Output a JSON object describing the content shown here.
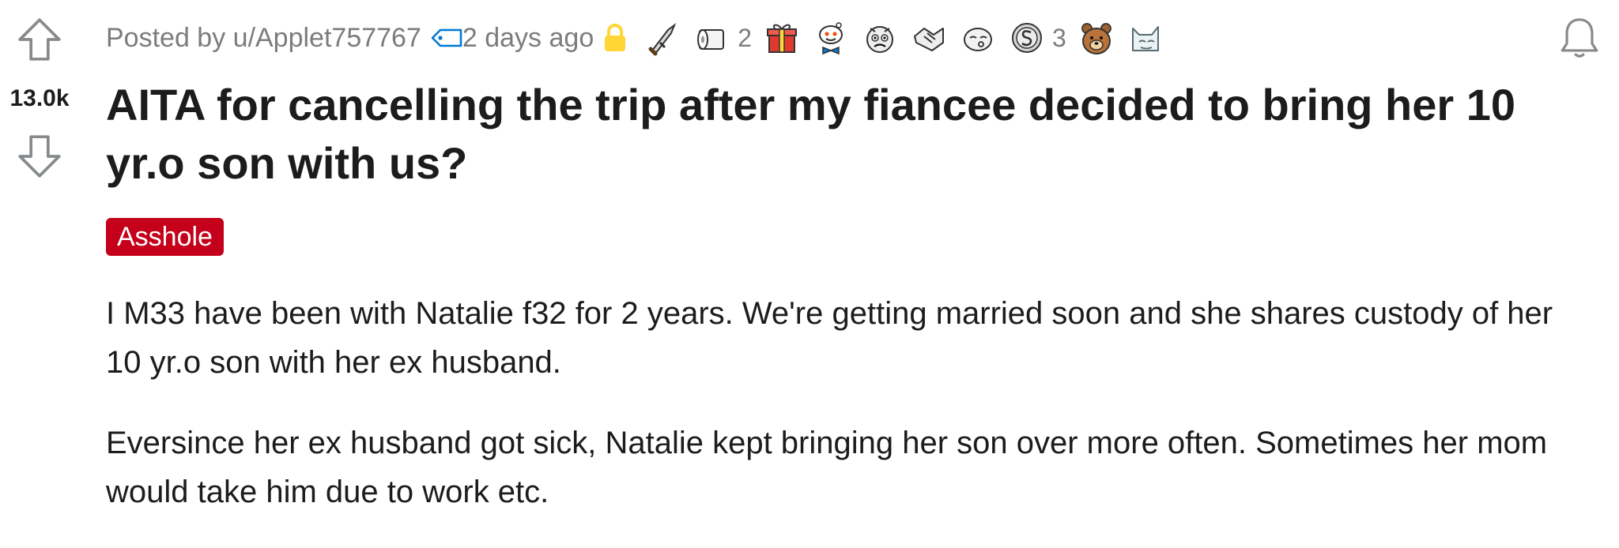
{
  "vote": {
    "score": "13.0k"
  },
  "meta": {
    "posted_by": "Posted by u/Applet757767",
    "time": "2 days ago"
  },
  "awards": [
    {
      "icon": "dagger-icon",
      "count": ""
    },
    {
      "icon": "toilet-paper-icon",
      "count": "2"
    },
    {
      "icon": "gift-icon",
      "count": ""
    },
    {
      "icon": "snoo-bowtie-icon",
      "count": ""
    },
    {
      "icon": "grumpy-face-icon",
      "count": ""
    },
    {
      "icon": "handshake-icon",
      "count": ""
    },
    {
      "icon": "sleepy-face-icon",
      "count": ""
    },
    {
      "icon": "silver-coin-icon",
      "count": "3"
    },
    {
      "icon": "bear-icon",
      "count": ""
    },
    {
      "icon": "cat-icon",
      "count": ""
    }
  ],
  "title": "AITA for cancelling the trip after my fiancee decided to bring her 10 yr.o son with us?",
  "flair": "Asshole",
  "body": {
    "paragraphs": [
      "I M33 have been with Natalie f32 for 2 years. We're getting married soon and she shares custody of her 10 yr.o son with her ex husband.",
      "Eversince her ex husband got sick, Natalie kept bringing her son over more often. Sometimes her mom would take him due to work etc."
    ]
  },
  "colors": {
    "flair_bg": "#c4001a",
    "meta_text": "#7c7c7c",
    "tag_blue": "#0079d3",
    "lock_gold": "#ffd635"
  }
}
